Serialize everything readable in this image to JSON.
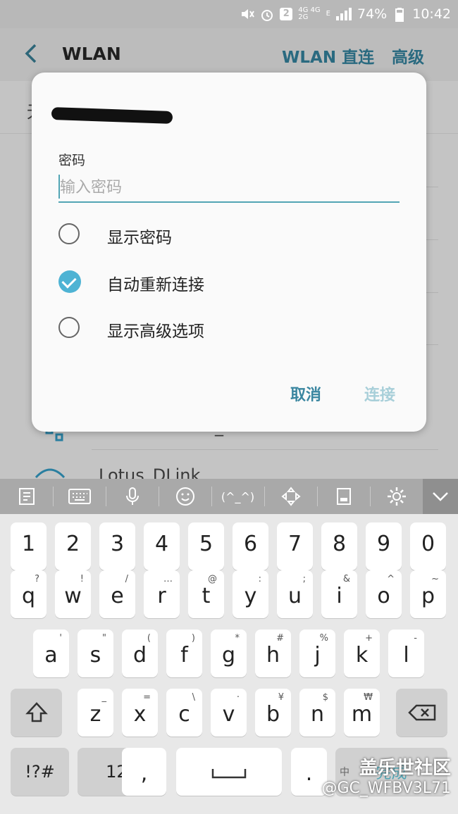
{
  "status_bar": {
    "sim_badge": "2",
    "net_top": "4G 4G",
    "net_bottom": "2G",
    "net_e": "E",
    "battery": "74%",
    "time": "10:42"
  },
  "app_bar": {
    "title": "WLAN",
    "action_direct": "WLAN 直连",
    "action_advanced": "高级"
  },
  "background": {
    "partial_text": "无",
    "network_2": "Lotus_DLink",
    "network_1_suffix": "_"
  },
  "dialog": {
    "password_label": "密码",
    "password_placeholder": "输入密码",
    "options": [
      {
        "label": "显示密码",
        "checked": false
      },
      {
        "label": "自动重新连接",
        "checked": true
      },
      {
        "label": "显示高级选项",
        "checked": false
      }
    ],
    "cancel_label": "取消",
    "connect_label": "连接",
    "accent_color": "#4eb3d4"
  },
  "keyboard": {
    "toolbar": [
      "clipboard-icon",
      "keyboard-icon",
      "mic-icon",
      "emoji-icon",
      "emoticon-icon",
      "cursor-move-icon",
      "one-hand-icon",
      "settings-icon",
      "collapse-icon"
    ],
    "emoticon_text": "(^_^)",
    "rows": {
      "numbers": [
        "1",
        "2",
        "3",
        "4",
        "5",
        "6",
        "7",
        "8",
        "9",
        "0"
      ],
      "row1": [
        {
          "main": "q",
          "sub": "?"
        },
        {
          "main": "w",
          "sub": "!"
        },
        {
          "main": "e",
          "sub": "/"
        },
        {
          "main": "r",
          "sub": "…"
        },
        {
          "main": "t",
          "sub": "@"
        },
        {
          "main": "y",
          "sub": ":"
        },
        {
          "main": "u",
          "sub": ";"
        },
        {
          "main": "i",
          "sub": "&"
        },
        {
          "main": "o",
          "sub": "^"
        },
        {
          "main": "p",
          "sub": "~"
        }
      ],
      "row2": [
        {
          "main": "a",
          "sub": "'"
        },
        {
          "main": "s",
          "sub": "\""
        },
        {
          "main": "d",
          "sub": "("
        },
        {
          "main": "f",
          "sub": ")"
        },
        {
          "main": "g",
          "sub": "*"
        },
        {
          "main": "h",
          "sub": "#"
        },
        {
          "main": "j",
          "sub": "%"
        },
        {
          "main": "k",
          "sub": "+"
        },
        {
          "main": "l",
          "sub": "-"
        }
      ],
      "row3": [
        {
          "main": "z",
          "sub": "_"
        },
        {
          "main": "x",
          "sub": "="
        },
        {
          "main": "c",
          "sub": "\\"
        },
        {
          "main": "v",
          "sub": "·"
        },
        {
          "main": "b",
          "sub": "¥"
        },
        {
          "main": "n",
          "sub": "$"
        },
        {
          "main": "m",
          "sub": "₩"
        }
      ]
    },
    "symbols_label": "!?#",
    "numbers_label": "123",
    "comma_label": ",",
    "period_label": ".",
    "lang_label": "中",
    "done_label": "完成"
  },
  "watermark": {
    "line1": "盖乐世社区",
    "line2": "@GC_WFBV3L71"
  }
}
